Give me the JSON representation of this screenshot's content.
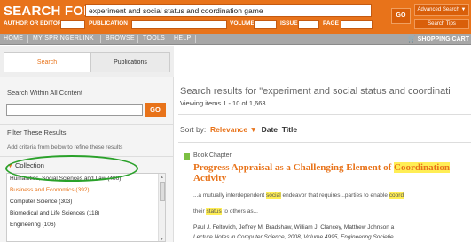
{
  "search": {
    "label": "SEARCH FOR",
    "query": "experiment and social status and coordination game",
    "author_label": "AUTHOR OR EDITOR",
    "publication_label": "PUBLICATION",
    "volume_label": "VOLUME",
    "issue_label": "ISSUE",
    "page_label": "PAGE",
    "go_label": "GO",
    "advanced_label": "Advanced Search ▼",
    "tips_label": "Search Tips"
  },
  "nav": {
    "items": [
      "HOME",
      "MY SPRINGERLINK",
      "BROWSE",
      "TOOLS",
      "HELP"
    ],
    "cart": "SHOPPING CART"
  },
  "sidebar": {
    "tabs": [
      "Search",
      "Publications"
    ],
    "search_within": "Search Within All Content",
    "go_label": "GO",
    "filter_heading": "Filter These Results",
    "filter_note": "Add criteria from below to refine these results",
    "collection_label": "Collection",
    "collections": [
      "Humanities, Social Sciences and Law (486)",
      "Business and Economics (392)",
      "Computer Science (303)",
      "Biomedical and Life Sciences (118)",
      "Engineering (106)"
    ],
    "highlight_color": "#2aa12a"
  },
  "results": {
    "title": "Search results for \"experiment and social status and coordinati",
    "viewing": "Viewing items 1 - 10 of 1,663",
    "sort_label": "Sort by:",
    "sort_relevance": "Relevance ▼",
    "sort_date": "Date",
    "sort_title": "Title",
    "item": {
      "type": "Book Chapter",
      "title_a": "Progress Appraisal as a Challenging Element of ",
      "title_hl": "Coordination",
      "title_b": "Activity",
      "snip1_a": "...a mutually interdependent ",
      "snip1_hl": "social",
      "snip1_b": " endeavor that requires...parties to enable ",
      "snip1_hl2": "coord",
      "snip2_a": "their ",
      "snip2_hl": "status",
      "snip2_b": " to others as...",
      "authors": "Paul J. Feltovich, Jeffrey M. Bradshaw, William J. Clancey, Matthew Johnson a",
      "pubinfo": "Lecture Notes in Computer Science, 2008, Volume 4995, Engineering Societie"
    }
  },
  "colors": {
    "brand_orange": "#e8731a",
    "nav_gray": "#a7a7a7",
    "highlight_yellow": "#ffee55"
  }
}
